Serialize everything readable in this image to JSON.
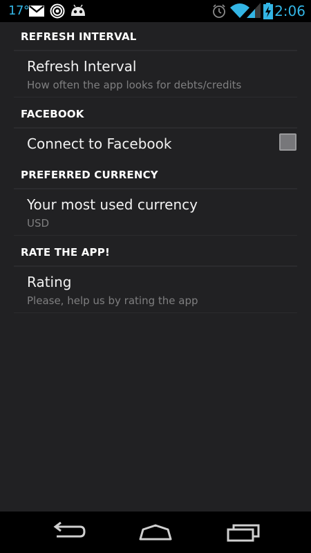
{
  "status_bar": {
    "temperature": "17°",
    "time": "2:06",
    "icons": [
      "gmail-icon",
      "hotspot-icon",
      "android-icon",
      "alarm-icon",
      "wifi-icon",
      "signal-icon",
      "battery-charging-icon"
    ],
    "accent_color": "#33b5e5"
  },
  "sections": [
    {
      "header": "REFRESH INTERVAL",
      "pref_title": "Refresh Interval",
      "pref_summary": "How often the app looks for debts/credits"
    },
    {
      "header": "FACEBOOK",
      "pref_title": "Connect to Facebook",
      "checkbox_checked": false
    },
    {
      "header": "PREFERRED CURRENCY",
      "pref_title": "Your most used currency",
      "pref_summary": "USD"
    },
    {
      "header": "RATE THE APP!",
      "pref_title": "Rating",
      "pref_summary": "Please, help us by rating the app"
    }
  ],
  "nav_bar": {
    "buttons": [
      "back-icon",
      "home-icon",
      "recent-apps-icon"
    ]
  }
}
